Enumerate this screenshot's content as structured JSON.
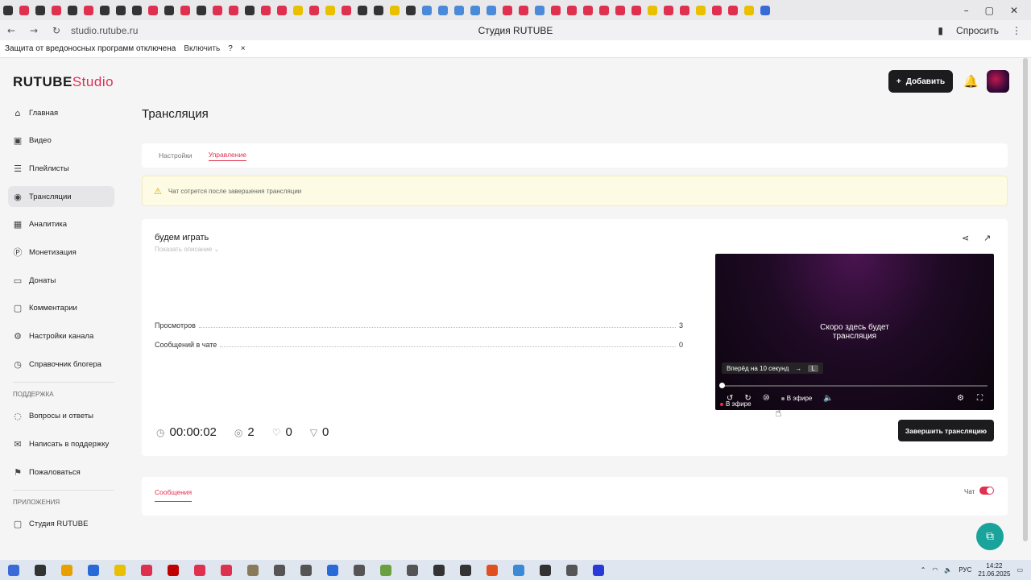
{
  "browser": {
    "url": "studio.rutube.ru",
    "page_title": "Студия RUTUBE",
    "ask_label": "Спросить",
    "nav_back": "←",
    "nav_forward": "→",
    "nav_reload": "↻",
    "tab_colors": [
      "#333",
      "#e03050",
      "#333",
      "#e03050",
      "#333",
      "#e03050",
      "#333",
      "#333",
      "#333",
      "#e03050",
      "#333",
      "#e03050",
      "#333",
      "#e03050",
      "#e03050",
      "#333",
      "#e03050",
      "#e03050",
      "#e8c000",
      "#e03050",
      "#e8c000",
      "#e03050",
      "#333",
      "#333",
      "#e8c000",
      "#333",
      "#4a8ad8",
      "#4a8ad8",
      "#4a8ad8",
      "#4a8ad8",
      "#4a8ad8",
      "#e03050",
      "#e03050",
      "#4a8ad8",
      "#e03050",
      "#e03050",
      "#e03050",
      "#e03050",
      "#e03050",
      "#e03050",
      "#e8c000",
      "#e03050",
      "#e03050",
      "#e8c000",
      "#e03050",
      "#e03050",
      "#e8c000",
      "#3a6ad8"
    ]
  },
  "warning_bar": {
    "text": "Защита от вредоносных программ отключена",
    "enable_label": "Включить",
    "help": "?",
    "close": "×"
  },
  "header": {
    "logo_main": "RUTUBE",
    "logo_suffix": "Studio",
    "add_label": "Добавить",
    "add_icon": "+",
    "bell_icon": "🔔"
  },
  "sidebar": {
    "items": [
      {
        "label": "Главная",
        "icon": "⌂"
      },
      {
        "label": "Видео",
        "icon": "▣"
      },
      {
        "label": "Плейлисты",
        "icon": "☰"
      },
      {
        "label": "Трансляции",
        "icon": "◉"
      },
      {
        "label": "Аналитика",
        "icon": "▦"
      },
      {
        "label": "Монетизация",
        "icon": "Ⓟ"
      },
      {
        "label": "Донаты",
        "icon": "▭"
      },
      {
        "label": "Комментарии",
        "icon": "▢"
      },
      {
        "label": "Настройки канала",
        "icon": "⚙"
      },
      {
        "label": "Справочник блогера",
        "icon": "◷"
      }
    ],
    "support_heading": "ПОДДЕРЖКА",
    "support": [
      {
        "label": "Вопросы и ответы",
        "icon": "◌"
      },
      {
        "label": "Написать в поддержку",
        "icon": "✉"
      },
      {
        "label": "Пожаловаться",
        "icon": "⚑"
      }
    ],
    "apps_heading": "ПРИЛОЖЕНИЯ",
    "apps": [
      {
        "label": "Студия RUTUBE",
        "icon": "▢"
      }
    ]
  },
  "page": {
    "title": "Трансляция",
    "tabs": [
      "Настройки",
      "Управление"
    ],
    "notice": "Чат сотрется после завершения трансляции",
    "stream_name": "будем играть",
    "show_desc": "Показать описание ⌄",
    "stats": [
      {
        "label": "Просмотров",
        "value": "3"
      },
      {
        "label": "Сообщений в чате",
        "value": "0"
      }
    ],
    "bottom": {
      "duration": "00:00:02",
      "viewers": "2",
      "likes": "0",
      "dislikes": "0"
    },
    "end_label": "Завершить трансляцию"
  },
  "player": {
    "soon_line1": "Скоро здесь будет",
    "soon_line2": "трансляция",
    "tip": "Вперёд на 10 секунд",
    "tip_arrow": "→",
    "tip_key": "L",
    "live_label": "В эфире",
    "progress": 0.01
  },
  "messages": {
    "tab": "Сообщения",
    "chat_label": "Чат"
  },
  "taskbar": {
    "lang": "РУС",
    "time": "14:22",
    "date": "21.06.2025",
    "icon_colors": [
      "#3a6ad8",
      "#333",
      "#e8a000",
      "#2a6ad8",
      "#e8c000",
      "#e03050",
      "#c00000",
      "#e03050",
      "#e03050",
      "#8a7a5a",
      "#555",
      "#555",
      "#2a6ad8",
      "#555",
      "#6aa040",
      "#555",
      "#333",
      "#333",
      "#e05020",
      "#3a8ad8",
      "#333",
      "#555",
      "#2a3ad8"
    ]
  }
}
